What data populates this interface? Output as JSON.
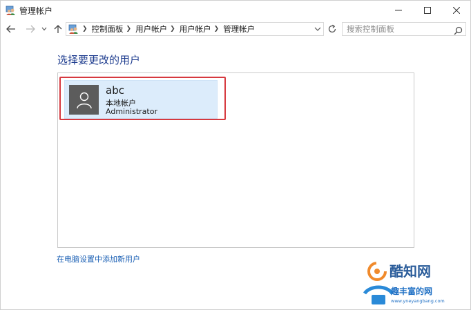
{
  "window": {
    "title": "管理帐户"
  },
  "navigation": {
    "breadcrumbs": [
      "控制面板",
      "用户帐户",
      "用户帐户",
      "管理帐户"
    ],
    "search_placeholder": "搜索控制面板"
  },
  "main": {
    "heading": "选择要更改的用户",
    "users": [
      {
        "name": "abc",
        "account_type": "本地帐户",
        "role": "Administrator",
        "selected": true
      }
    ],
    "add_user_link": "在电脑设置中添加新用户"
  },
  "watermark": {
    "brand": "酷知网",
    "sub_brand": "趣丰富的网",
    "url": "www.yneyangbang.com"
  },
  "colors": {
    "heading": "#1f3d8f",
    "link": "#1a5fb4",
    "tile_background": "#dcecfb",
    "highlight_frame": "#d6393f",
    "avatar": "#5c5c5c"
  },
  "icons": {
    "title": "users-control-panel-icon",
    "back": "arrow-left-icon",
    "forward": "arrow-right-icon",
    "up": "arrow-up-icon",
    "refresh": "refresh-icon",
    "search": "search-icon",
    "avatar": "user-silhouette-icon"
  }
}
